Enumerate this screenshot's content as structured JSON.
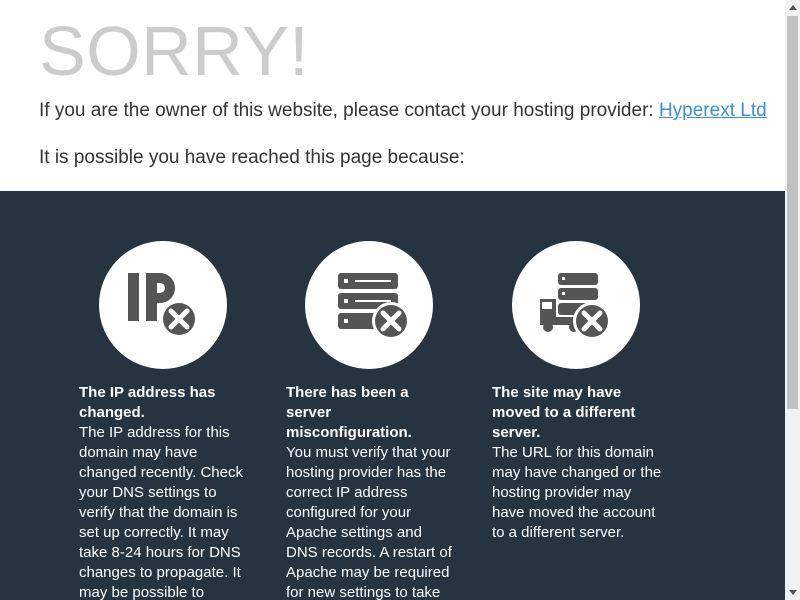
{
  "header": {
    "title": "SORRY!",
    "owner_prefix": "If you are the owner of this website, please contact your hosting provider: ",
    "provider_link": "Hyperext Ltd",
    "reason_intro": "It is possible you have reached this page because:"
  },
  "reasons": [
    {
      "icon": "ip-error-icon",
      "title": "The IP address has changed.",
      "body": "The IP address for this domain may have changed recently. Check your DNS settings to verify that the domain is set up correctly. It may take 8-24 hours for DNS changes to propagate. It may be possible to restore access"
    },
    {
      "icon": "server-error-icon",
      "title": "There has been a server misconfiguration.",
      "body": "You must verify that your hosting provider has the correct IP address configured for your Apache settings and DNS records. A restart of Apache may be required for new settings to take effect."
    },
    {
      "icon": "server-moved-icon",
      "title": "The site may have moved to a different server.",
      "body": "The URL for this domain may have changed or the hosting provider may have moved the account to a different server."
    }
  ],
  "colors": {
    "dark_section": "#263341",
    "link": "#3a8fd6",
    "title_gray": "#cccccc",
    "icon_gray": "#555555"
  }
}
